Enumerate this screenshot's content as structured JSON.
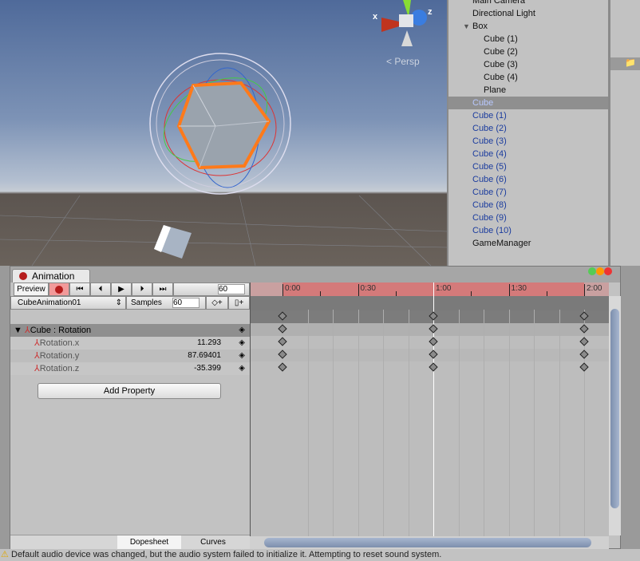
{
  "scene": {
    "gizmo_x": "x",
    "gizmo_z": "z",
    "projection": "Persp",
    "colors": {
      "selection": "#ff7a1a"
    }
  },
  "hierarchy": {
    "items": [
      {
        "label": "Main Camera",
        "indent": 0,
        "style": "normal"
      },
      {
        "label": "Directional Light",
        "indent": 0,
        "style": "normal"
      },
      {
        "label": "Box",
        "indent": 0,
        "style": "normal",
        "expanded": true
      },
      {
        "label": "Cube (1)",
        "indent": 1,
        "style": "normal"
      },
      {
        "label": "Cube (2)",
        "indent": 1,
        "style": "normal"
      },
      {
        "label": "Cube (3)",
        "indent": 1,
        "style": "normal"
      },
      {
        "label": "Cube (4)",
        "indent": 1,
        "style": "normal"
      },
      {
        "label": "Plane",
        "indent": 1,
        "style": "normal"
      },
      {
        "label": "Cube",
        "indent": 0,
        "style": "sel"
      },
      {
        "label": "Cube (1)",
        "indent": 0,
        "style": "blue"
      },
      {
        "label": "Cube (2)",
        "indent": 0,
        "style": "blue"
      },
      {
        "label": "Cube (3)",
        "indent": 0,
        "style": "blue"
      },
      {
        "label": "Cube (4)",
        "indent": 0,
        "style": "blue"
      },
      {
        "label": "Cube (5)",
        "indent": 0,
        "style": "blue"
      },
      {
        "label": "Cube (6)",
        "indent": 0,
        "style": "blue"
      },
      {
        "label": "Cube (7)",
        "indent": 0,
        "style": "blue"
      },
      {
        "label": "Cube (8)",
        "indent": 0,
        "style": "blue"
      },
      {
        "label": "Cube (9)",
        "indent": 0,
        "style": "blue"
      },
      {
        "label": "Cube (10)",
        "indent": 0,
        "style": "blue"
      },
      {
        "label": "GameManager",
        "indent": 0,
        "style": "normal"
      }
    ]
  },
  "animation": {
    "tab_label": "Animation",
    "preview_label": "Preview",
    "frame": "60",
    "clip": "CubeAnimation01",
    "samples_label": "Samples",
    "samples": "60",
    "group": {
      "label": "Cube : Rotation"
    },
    "properties": [
      {
        "label": "Rotation.x",
        "value": "11.293"
      },
      {
        "label": "Rotation.y",
        "value": "87.69401"
      },
      {
        "label": "Rotation.z",
        "value": "-35.399"
      }
    ],
    "add_property": "Add Property",
    "tabs": {
      "dopesheet": "Dopesheet",
      "curves": "Curves"
    },
    "ruler_labels": [
      "0:00",
      "0:30",
      "1:00",
      "1:30",
      "2:00"
    ],
    "keyframe_times_sec": [
      0,
      60,
      120
    ],
    "playhead_sec": 60,
    "colors": {
      "ruler": "#d47a7a",
      "record": "#b51c1c"
    }
  },
  "status": {
    "message": "Default audio device was changed, but the audio system failed to initialize it. Attempting to reset sound system."
  }
}
